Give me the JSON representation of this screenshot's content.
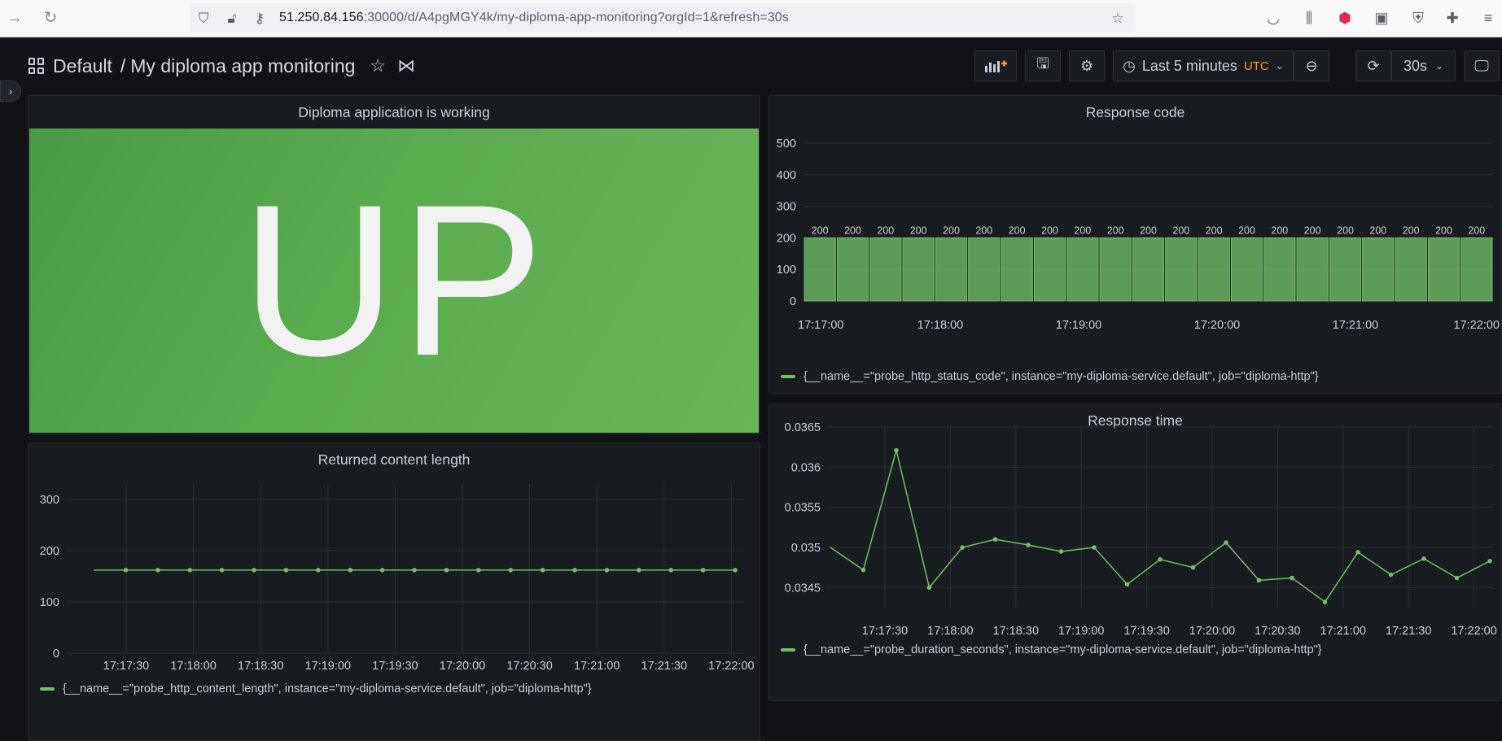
{
  "browser": {
    "url_host": "51.250.84.156",
    "url_rest": ":30000/d/A4pgMGY4k/my-diploma-app-monitoring?orgId=1&refresh=30s"
  },
  "dashboard": {
    "folder": "Default",
    "separator": "/",
    "title": "My diploma app monitoring",
    "time_range_label": "Last 5 minutes",
    "timezone": "UTC",
    "refresh_interval": "30s"
  },
  "panels": {
    "status": {
      "title": "Diploma application is working",
      "value": "UP",
      "color": "#5aab4e"
    },
    "response_code": {
      "title": "Response code",
      "legend": "{__name__=\"probe_http_status_code\", instance=\"my-diploma-service.default\", job=\"diploma-http\"}"
    },
    "content_length": {
      "title": "Returned content length",
      "legend": "{__name__=\"probe_http_content_length\", instance=\"my-diploma-service.default\", job=\"diploma-http\"}"
    },
    "response_time": {
      "title": "Response time",
      "legend": "{__name__=\"probe_duration_seconds\", instance=\"my-diploma-service.default\", job=\"diploma-http\"}"
    }
  },
  "chart_data": [
    {
      "type": "bar",
      "title": "Response code",
      "series": [
        {
          "name": "{__name__=\"probe_http_status_code\", instance=\"my-diploma-service.default\", job=\"diploma-http\"}",
          "values": [
            200,
            200,
            200,
            200,
            200,
            200,
            200,
            200,
            200,
            200,
            200,
            200,
            200,
            200,
            200,
            200,
            200,
            200,
            200,
            200,
            200
          ]
        }
      ],
      "x_tick_labels": [
        "17:17:00",
        "17:18:00",
        "17:19:00",
        "17:20:00",
        "17:21:00",
        "17:22:00"
      ],
      "y_ticks": [
        0,
        100,
        200,
        300,
        400,
        500
      ],
      "ylim": [
        0,
        500
      ],
      "bar_label": "200",
      "color": "#73bf69"
    },
    {
      "type": "line",
      "title": "Returned content length",
      "series": [
        {
          "name": "{__name__=\"probe_http_content_length\", instance=\"my-diploma-service.default\", job=\"diploma-http\"}",
          "values": [
            162,
            162,
            162,
            162,
            162,
            162,
            162,
            162,
            162,
            162,
            162,
            162,
            162,
            162,
            162,
            162,
            162,
            162,
            162,
            162,
            162
          ]
        }
      ],
      "x_tick_labels": [
        "17:17:30",
        "17:18:00",
        "17:18:30",
        "17:19:00",
        "17:19:30",
        "17:20:00",
        "17:20:30",
        "17:21:00",
        "17:21:30",
        "17:22:00"
      ],
      "y_ticks": [
        0,
        100,
        200,
        300
      ],
      "ylim": [
        0,
        330
      ],
      "color": "#73bf69"
    },
    {
      "type": "line",
      "title": "Response time",
      "series": [
        {
          "name": "{__name__=\"probe_duration_seconds\", instance=\"my-diploma-service.default\", job=\"diploma-http\"}",
          "values": [
            0.035,
            0.03472,
            0.03621,
            0.0345,
            0.035,
            0.0351,
            0.03503,
            0.03495,
            0.035,
            0.03454,
            0.03485,
            0.03475,
            0.03506,
            0.03459,
            0.03462,
            0.03432,
            0.03494,
            0.03466,
            0.03486,
            0.03462,
            0.03483
          ]
        }
      ],
      "x_tick_labels": [
        "17:17:30",
        "17:18:00",
        "17:18:30",
        "17:19:00",
        "17:19:30",
        "17:20:00",
        "17:20:30",
        "17:21:00",
        "17:21:30",
        "17:22:00"
      ],
      "y_ticks": [
        "0.0345",
        "0.035",
        "0.0355",
        "0.036",
        "0.0365"
      ],
      "ylim": [
        0.03425,
        0.0365
      ],
      "color": "#73bf69"
    }
  ]
}
